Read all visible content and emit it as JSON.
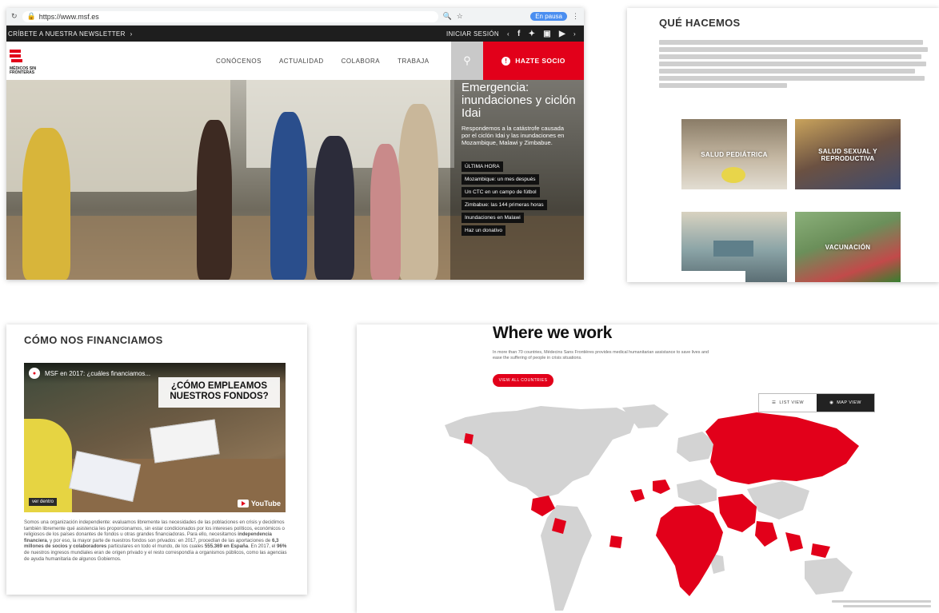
{
  "browser": {
    "url": "https://www.msf.es",
    "profile_chip": "En pausa"
  },
  "homepage": {
    "newsletter_label": "CRÍBETE A NUESTRA NEWSLETTER",
    "login_label": "INICIAR SESIÓN",
    "social_icons": [
      "facebook-icon",
      "twitter-icon",
      "instagram-icon",
      "youtube-icon"
    ],
    "logo_text": "MÉDICOS SIN FRONTERAS",
    "nav": [
      "CONÓCENOS",
      "ACTUALIDAD",
      "COLABORA",
      "TRABAJA"
    ],
    "cta_label": "HAZTE SOCIO",
    "hero_title": "Emergencia: inundaciones y ciclón Idai",
    "hero_subtitle": "Respondemos a la catástrofe causada por el ciclón Idai y las inundaciones en Mozambique, Malawi y Zimbabue.",
    "hero_links": [
      "ÚLTIMA HORA",
      "Mozambique: un mes después",
      "Un CTC en un campo de fútbol",
      "Zimbabue: las 144 primeras horas",
      "Inundaciones en Malawi",
      "Haz un donativo"
    ]
  },
  "que_hacemos": {
    "title": "QUÉ HACEMOS",
    "tiles": [
      "SALUD PEDIÁTRICA",
      "SALUD SEXUAL Y REPRODUCTIVA",
      "",
      "VACUNACIÓN"
    ]
  },
  "financiamos": {
    "title": "CÓMO NOS FINANCIAMOS",
    "video_title": "MSF en 2017: ¿cuáles financiamos...",
    "video_headline": "¿CÓMO EMPLEAMOS NUESTROS FONDOS?",
    "video_badge": "ver dentro",
    "video_platform": "YouTube",
    "paragraph_parts": [
      "Somos una organización independiente: evaluamos libremente las necesidades de las poblaciones en crisis y decidimos también libremente qué asistencia les proporcionamos, sin estar condicionados por los intereses políticos, económicos o religiosos de los países donantes de fondos u otras grandes financiadoras. Para ello, necesitamos ",
      "independencia financiera",
      ", y por eso, la mayor parte de nuestros fondos son privados: en 2017, procedían de las aportaciones de ",
      "6,3 millones de socios y colaboradores",
      " particulares en todo el mundo, de los cuales ",
      "555.369 en España",
      ". En 2017, el ",
      "96%",
      " de nuestros ingresos mundiales eran de origen privado y el resto correspondía a organismos públicos, como las agencias de ayuda humanitaria de algunos Gobiernos."
    ]
  },
  "where_we_work": {
    "title": "Where we work",
    "subtitle": "In more than 70 countries, Médecins Sans Frontières provides medical humanitarian assistance to save lives and ease the suffering of people in crisis situations.",
    "button_label": "VIEW ALL COUNTRIES",
    "view_toggle": [
      "LIST VIEW",
      "MAP VIEW"
    ],
    "active_view": "MAP VIEW",
    "map_colors": {
      "active": "#e2001a",
      "inactive": "#d3d3d3"
    }
  }
}
